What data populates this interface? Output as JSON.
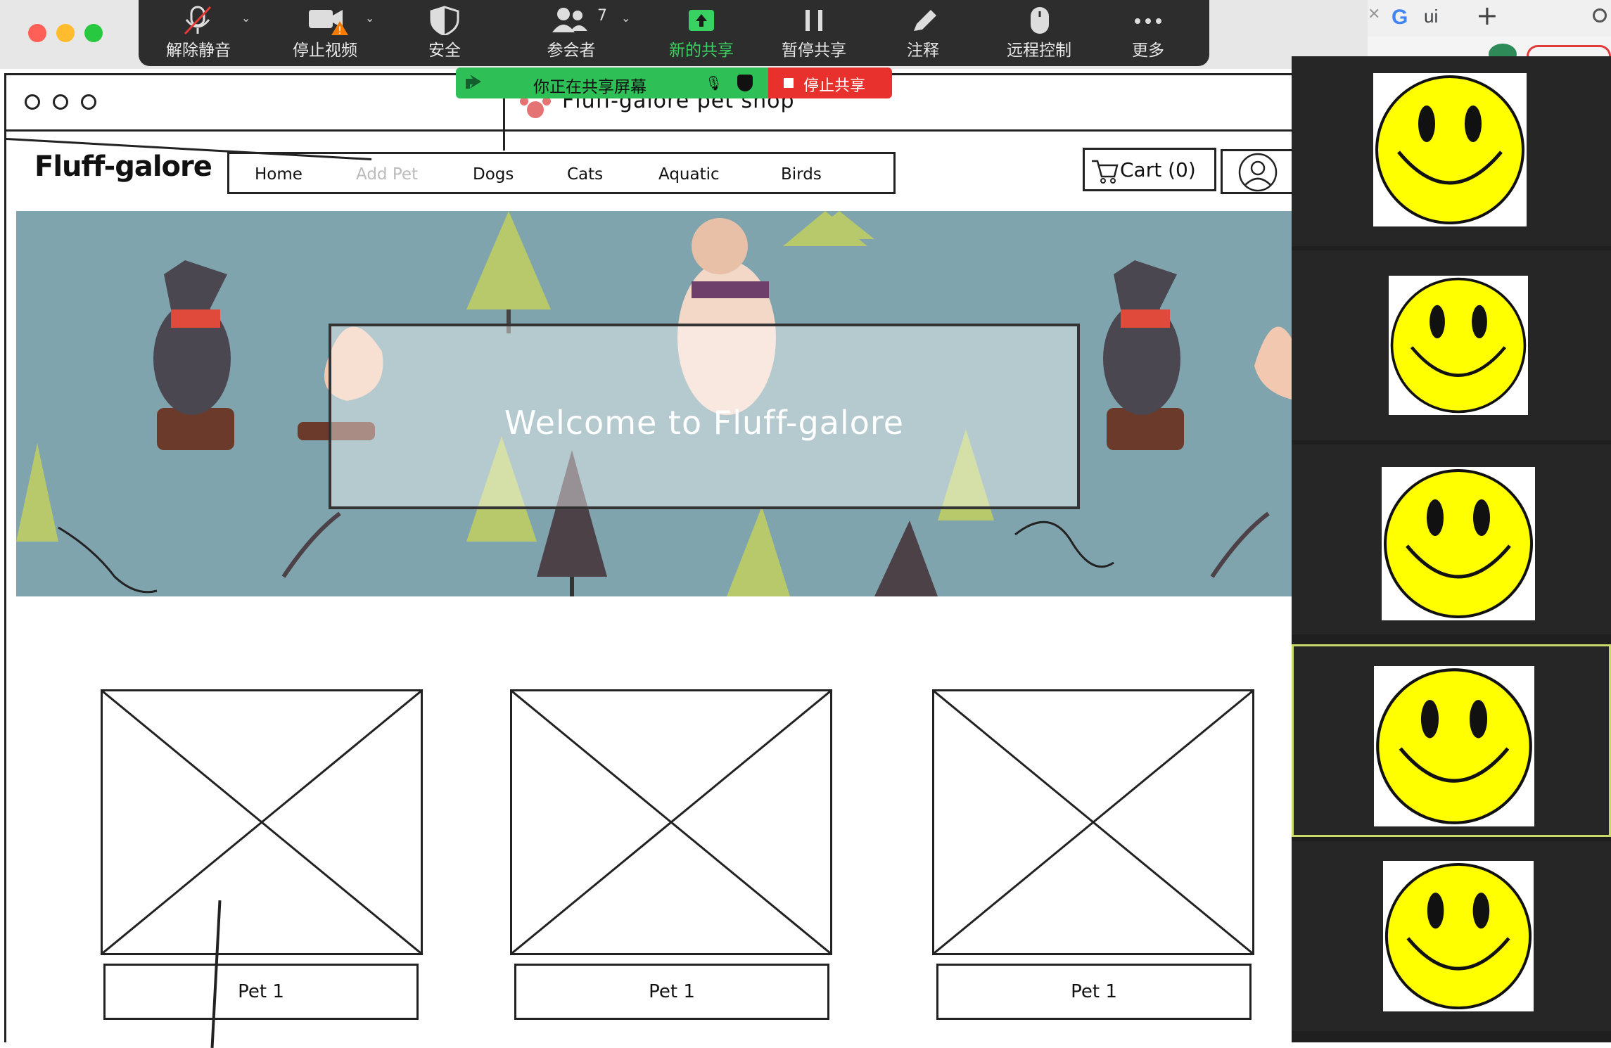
{
  "zoom_toolbar": {
    "buttons": [
      {
        "label": "解除静音",
        "icon": "microphone-muted-icon"
      },
      {
        "label": "停止视频",
        "icon": "video-camera-warning-icon"
      },
      {
        "label": "安全",
        "icon": "shield-icon"
      },
      {
        "label": "参会者",
        "icon": "participants-icon",
        "count": "7"
      },
      {
        "label": "新的共享",
        "icon": "share-screen-icon"
      },
      {
        "label": "暂停共享",
        "icon": "pause-icon"
      },
      {
        "label": "注释",
        "icon": "pencil-icon"
      },
      {
        "label": "远程控制",
        "icon": "mouse-icon"
      },
      {
        "label": "更多",
        "icon": "more-dots-icon"
      }
    ],
    "accent_green": "#39d262"
  },
  "share_bar": {
    "status_text": "你正在共享屏幕",
    "stop_label": "停止共享",
    "green": "#2ec057",
    "red": "#e8302c"
  },
  "browser": {
    "tab_text": "ui",
    "google_logo": "G"
  },
  "wireframe": {
    "site_title": "Fluff-galore pet shop",
    "logo": "Fluff-galore",
    "nav": [
      "Home",
      "Add Pet",
      "Dogs",
      "Cats",
      "Aquatic",
      "Birds"
    ],
    "cart_label": "Cart (0)",
    "hero_text": "Welcome to Fluff-galore",
    "products": [
      {
        "label": "Pet 1"
      },
      {
        "label": "Pet 1"
      },
      {
        "label": "Pet 1"
      }
    ]
  },
  "video_panel": {
    "tiles": 5,
    "active_tile": 4,
    "smiley_color": "#ffff00"
  }
}
